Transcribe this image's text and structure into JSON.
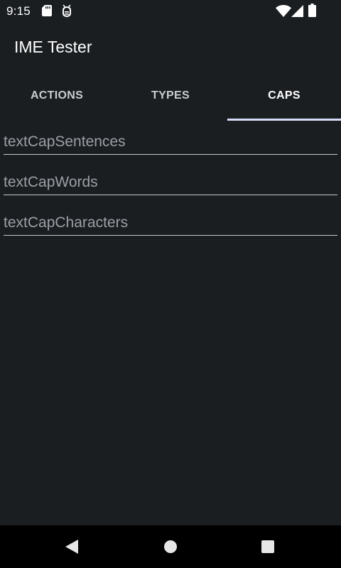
{
  "status_bar": {
    "time": "9:15",
    "icons": [
      "sd-card-icon",
      "debug-icon",
      "wifi-icon",
      "signal-icon",
      "battery-icon"
    ]
  },
  "app_bar": {
    "title": "IME Tester"
  },
  "tabs": [
    {
      "label": "ACTIONS",
      "selected": false
    },
    {
      "label": "TYPES",
      "selected": false
    },
    {
      "label": "CAPS",
      "selected": true
    }
  ],
  "fields": [
    {
      "placeholder": "textCapSentences",
      "value": ""
    },
    {
      "placeholder": "textCapWords",
      "value": ""
    },
    {
      "placeholder": "textCapCharacters",
      "value": ""
    }
  ],
  "nav_bar": {
    "buttons": [
      "back-icon",
      "home-icon",
      "recents-icon"
    ]
  },
  "colors": {
    "background": "#1b1e21",
    "tab_indicator": "#d6dcf7",
    "underline": "#c7c9cc",
    "hint_text": "#9aa0a6",
    "nav_bar": "#000000"
  }
}
